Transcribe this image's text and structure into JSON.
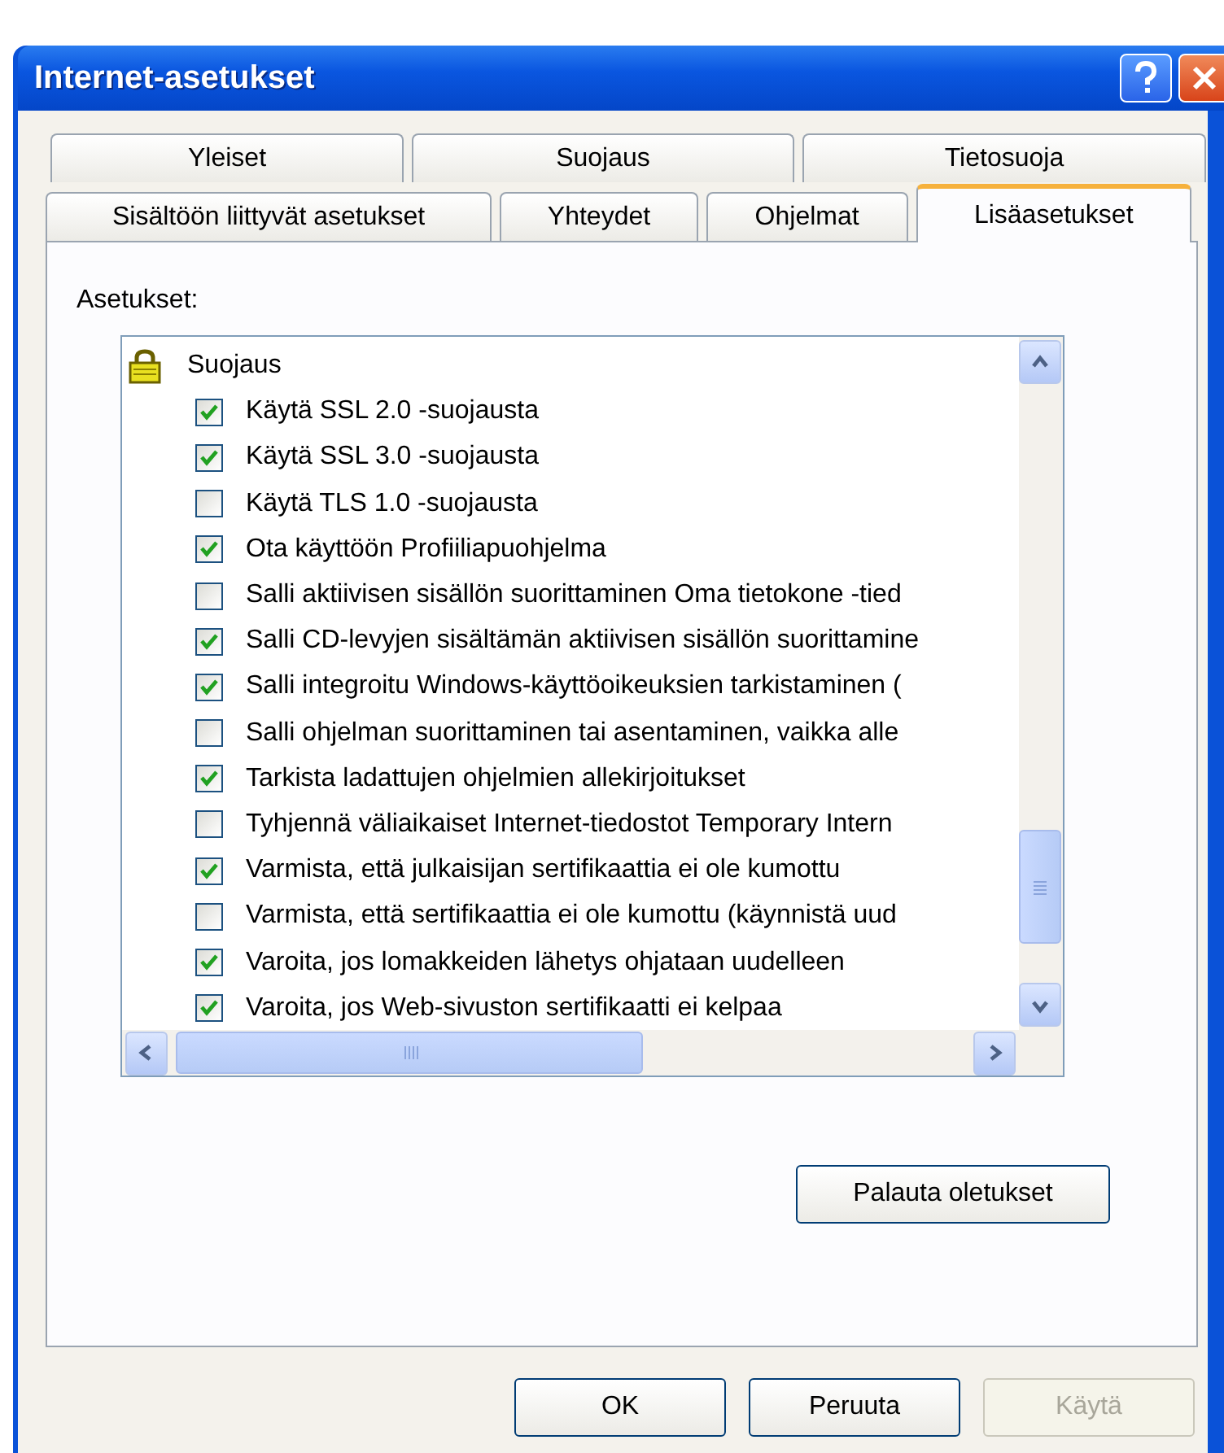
{
  "window": {
    "title": "Internet-asetukset"
  },
  "tab_rows": [
    {
      "tabs": [
        {
          "label": "Yleiset",
          "selected": false
        },
        {
          "label": "Suojaus",
          "selected": false
        },
        {
          "label": "Tietosuoja",
          "selected": false
        }
      ]
    },
    {
      "tabs": [
        {
          "label": "Sisältöön liittyvät asetukset",
          "selected": false
        },
        {
          "label": "Yhteydet",
          "selected": false
        },
        {
          "label": "Ohjelmat",
          "selected": false
        },
        {
          "label": "Lisäasetukset",
          "selected": true
        }
      ]
    }
  ],
  "settings_label": "Asetukset:",
  "settings": [
    {
      "label": "Suojaus",
      "children": [
        {
          "label": "Käytä SSL 2.0 -suojausta",
          "checked": true
        },
        {
          "label": "Käytä SSL 3.0 -suojausta",
          "checked": true
        },
        {
          "label": "Käytä TLS 1.0 -suojausta",
          "checked": false
        },
        {
          "label": "Ota käyttöön Profiiliapuohjelma",
          "checked": true
        },
        {
          "label": "Salli aktiivisen sisällön suorittaminen Oma tietokone -tied",
          "checked": false
        },
        {
          "label": "Salli CD-levyjen sisältämän aktiivisen sisällön suorittamine",
          "checked": true
        },
        {
          "label": "Salli integroitu Windows-käyttöoikeuksien tarkistaminen (",
          "checked": true
        },
        {
          "label": "Salli ohjelman suorittaminen tai asentaminen, vaikka alle",
          "checked": false
        },
        {
          "label": "Tarkista ladattujen ohjelmien allekirjoitukset",
          "checked": true
        },
        {
          "label": "Tyhjennä väliaikaiset Internet-tiedostot Temporary Intern",
          "checked": false
        },
        {
          "label": "Varmista, että julkaisijan sertifikaattia ei ole kumottu",
          "checked": true
        },
        {
          "label": "Varmista, että sertifikaattia ei ole kumottu (käynnistä uud",
          "checked": false
        },
        {
          "label": "Varoita, jos lomakkeiden lähetys ohjataan uudelleen",
          "checked": true
        },
        {
          "label": "Varoita, jos Web-sivuston sertifikaatti ei kelpaa",
          "checked": true
        }
      ]
    }
  ],
  "restore_button": {
    "label": "Palauta oletukset",
    "disabled": false
  },
  "buttons": [
    {
      "label": "OK",
      "disabled": false
    },
    {
      "label": "Peruuta",
      "disabled": false
    },
    {
      "label": "Käytä",
      "disabled": true
    }
  ]
}
